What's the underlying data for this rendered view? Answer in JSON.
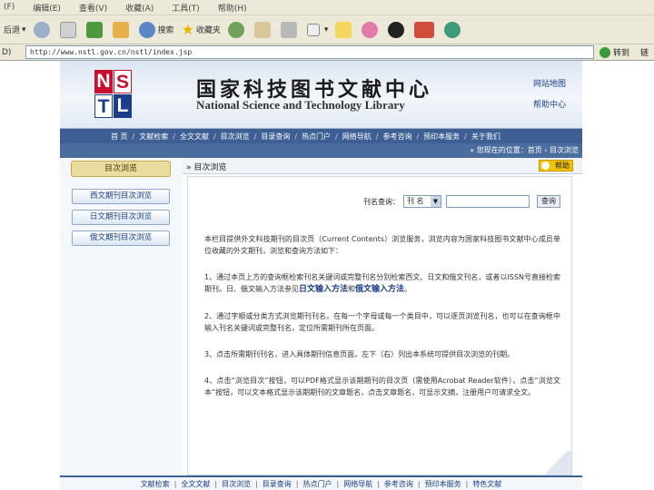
{
  "browser": {
    "menu": [
      "(F)",
      "编辑(E)",
      "查看(V)",
      "收藏(A)",
      "工具(T)",
      "帮助(H)"
    ],
    "toolbar": {
      "back_label": "后退",
      "search_label": "搜索",
      "favorites_label": "收藏夹"
    },
    "address_label": "D)",
    "address_url": "http://www.nstl.gov.cn/nstl/index.jsp",
    "go_label": "转到",
    "links_label": "链"
  },
  "header": {
    "logo_letters": [
      "N",
      "S",
      "T",
      "L"
    ],
    "title_cn": "国家科技图书文献中心",
    "title_en": "National Science and Technology Library",
    "links": [
      "网站地图",
      "帮助中心"
    ]
  },
  "nav": {
    "items": [
      "首 页",
      "文献检索",
      "全文文献",
      "目次浏览",
      "目录查询",
      "热点门户",
      "网络导航",
      "参考咨询",
      "预印本服务",
      "关于我们"
    ]
  },
  "breadcrumb": "» 您现在的位置：首页 › 目次浏览",
  "sidebar": {
    "current": "目次浏览",
    "items": [
      "西文期刊目次浏览",
      "日文期刊目次浏览",
      "俄文期刊目次浏览"
    ]
  },
  "main": {
    "title": "目次浏览",
    "help_label": "帮助"
  },
  "search": {
    "label": "刊名查询：",
    "select_value": "刊 名",
    "input_value": "",
    "button_label": "查询"
  },
  "article": {
    "p1": "本栏目提供外文科技期刊的目次页（Current Contents）浏览服务，浏览内容为国家科技图书文献中心成员单位收藏的外文期刊，浏览和查询方法如下：",
    "p2_pre": "1、通过本页上方的查询框检索刊名关键词或完整刊名分别检索西文、日文和俄文刊名，或者以ISSN号直接检索期刊。日、俄文输入方法参见",
    "p2_link1": "日文输入方法",
    "p2_mid": "和",
    "p2_link2": "俄文输入方法",
    "p2_end": "。",
    "p3": "2、通过字顺或分类方式浏览期刊刊名。在每一个字母或每一个类目中，可以逐页浏览刊名，也可以在查询框中输入刊名关键词或完整刊名，定位所需期刊所在页面。",
    "p4": "3、点击所需期刊刊名，进入具体期刊信息页面，左下（右）列出本系统可提供目次浏览的刊期。",
    "p5": "4、点击“浏览目次”按钮，可以PDF格式显示该期期刊的目次页（需使用Acrobat Reader软件），点击“浏览文本”按钮，可以文本格式显示该期期刊的文章题名，点击文章题名，可显示文摘，注册用户可请求全文。"
  },
  "footer": {
    "items": [
      "文献检索",
      "全文文献",
      "目次浏览",
      "目录查询",
      "热点门户",
      "网络导航",
      "参考咨询",
      "预印本服务",
      "特色文献"
    ]
  },
  "colors": {
    "nav_blue": "#3d5f93",
    "logo_red": "#c8102e",
    "logo_blue": "#1c3f8c",
    "help_yellow": "#f2c200"
  }
}
